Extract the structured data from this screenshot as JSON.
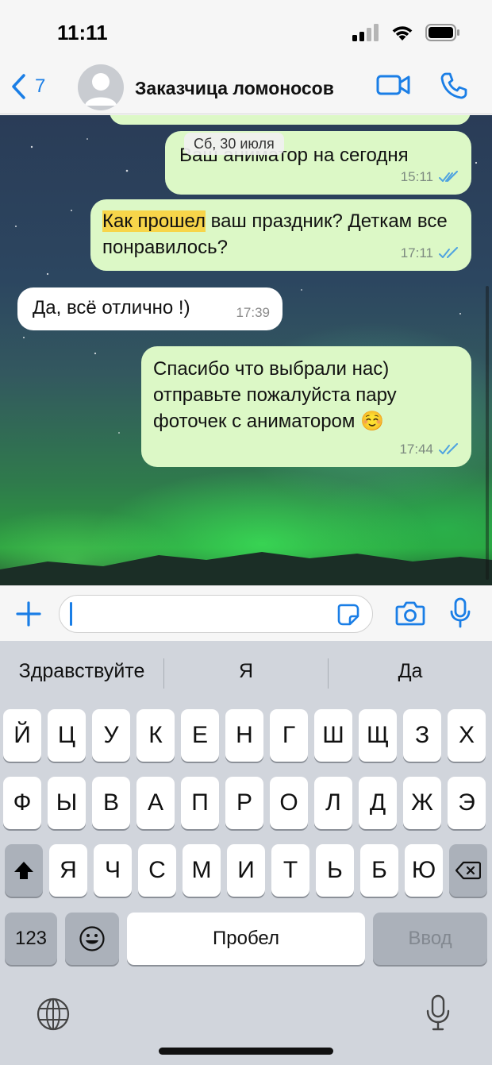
{
  "status_bar": {
    "time": "11:11"
  },
  "header": {
    "back_count": "7",
    "contact_name": "Заказчица ломоносов"
  },
  "chat": {
    "date_pill": "Сб, 30 июля",
    "messages": [
      {
        "direction": "out",
        "text": "Ваш аниматор на сегодня",
        "time": "15:11",
        "read": true
      },
      {
        "direction": "out",
        "highlight": "Как прошел",
        "text": " ваш праздник? Деткам все понравилось?",
        "time": "17:11",
        "read": true
      },
      {
        "direction": "in",
        "text": "Да, всё отлично !)",
        "time": "17:39"
      },
      {
        "direction": "out",
        "text": "Спасибо что выбрали нас) отправьте пожалуйста пару фоточек с аниматором ☺️",
        "time": "17:44",
        "read": true
      }
    ]
  },
  "input": {
    "value": ""
  },
  "keyboard": {
    "suggestions": [
      "Здравствуйте",
      "Я",
      "Да"
    ],
    "row1": [
      "Й",
      "Ц",
      "У",
      "К",
      "Е",
      "Н",
      "Г",
      "Ш",
      "Щ",
      "З",
      "Х"
    ],
    "row2": [
      "Ф",
      "Ы",
      "В",
      "А",
      "П",
      "Р",
      "О",
      "Л",
      "Д",
      "Ж",
      "Э"
    ],
    "row3": [
      "Я",
      "Ч",
      "С",
      "М",
      "И",
      "Т",
      "Ь",
      "Б",
      "Ю"
    ],
    "numbers_label": "123",
    "space_label": "Пробел",
    "return_label": "Ввод"
  },
  "colors": {
    "accent": "#1a7ee6",
    "outgoing_bubble": "#dcf8c6",
    "incoming_bubble": "#ffffff",
    "read_ticks": "#4fa3e0",
    "highlight": "#f7d54a"
  },
  "icons": [
    "back-chevron-icon",
    "avatar-placeholder-icon",
    "video-call-icon",
    "phone-call-icon",
    "plus-icon",
    "sticker-icon",
    "camera-icon",
    "microphone-icon",
    "shift-icon",
    "backspace-icon",
    "emoji-icon",
    "globe-icon",
    "dictation-icon",
    "double-check-icon"
  ]
}
